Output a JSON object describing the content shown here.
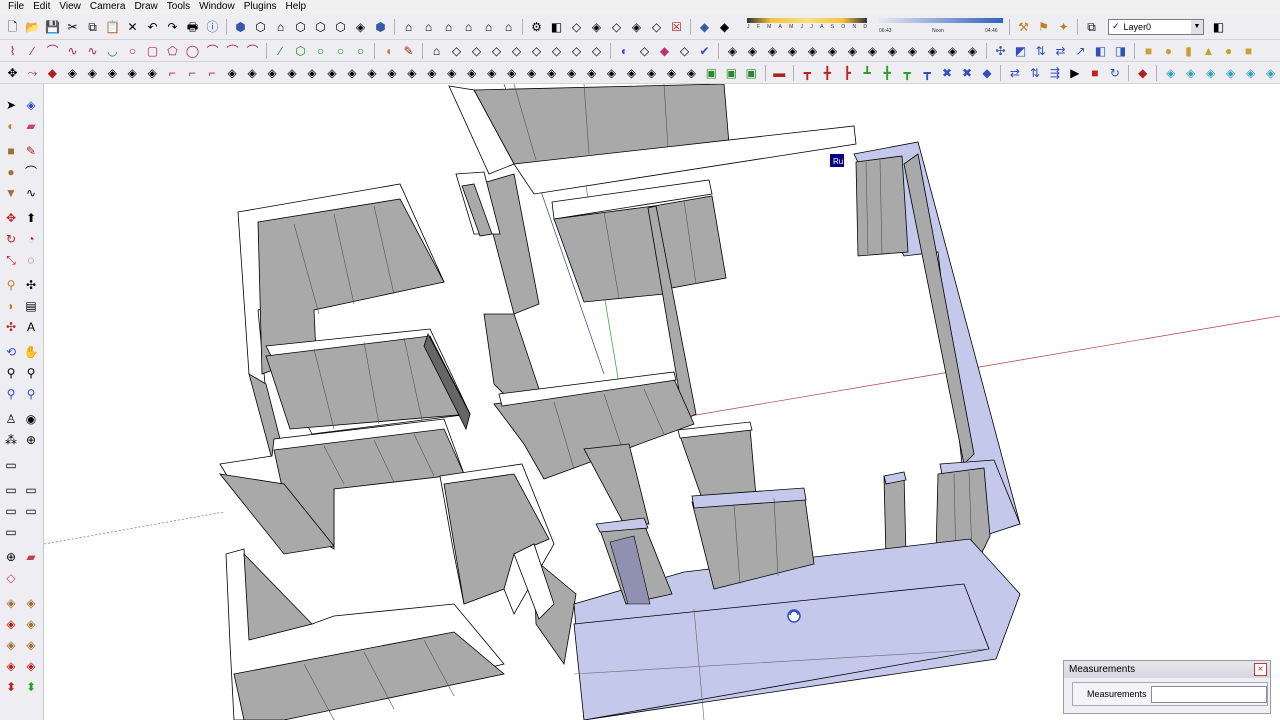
{
  "menu": [
    "File",
    "Edit",
    "View",
    "Camera",
    "Draw",
    "Tools",
    "Window",
    "Plugins",
    "Help"
  ],
  "shadow_settings": {
    "months": [
      "J",
      "F",
      "M",
      "A",
      "M",
      "J",
      "J",
      "A",
      "S",
      "O",
      "N",
      "D"
    ],
    "sunrise": "06:43",
    "noon": "Noon",
    "sunset": "04:46"
  },
  "layer": {
    "name": "Layer0",
    "visible_check": "✓"
  },
  "viewport": {
    "tag_label": "Ru"
  },
  "measurements": {
    "title": "Measurements",
    "label": "Measurements",
    "value": ""
  },
  "colors": {
    "face_gray": "#a9a9a9",
    "face_light": "#ffffff",
    "face_blue": "#c4c9ec",
    "axis_blue": "#3a3aa0",
    "axis_green": "#2aa02a",
    "axis_red": "#b04040",
    "toolbar_bg": "#eeeef2"
  },
  "toolbar_icons": {
    "row1": [
      "new-icon",
      "open-icon",
      "save-icon",
      "cut-icon",
      "copy-icon",
      "paste-icon",
      "erase-icon",
      "undo-icon",
      "redo-icon",
      "print-icon",
      "model-info-icon",
      "iso-view-icon",
      "top-view-icon",
      "front-view-icon",
      "right-view-icon",
      "back-view-icon",
      "left-view-icon",
      "xray-icon",
      "wireframe-icon",
      "hidden-line-icon",
      "shaded-icon",
      "textured-icon",
      "monochrome-icon",
      "shadow-toggle-icon",
      "fog-icon",
      "get-models-icon",
      "share-model-icon",
      "component-icon",
      "ruby-console-icon"
    ],
    "row2": [
      "freehand-icon",
      "line-icon",
      "arc-icon",
      "circle-icon",
      "polygon-icon",
      "rect-icon",
      "bezier-icon",
      "spline-icon",
      "offset-icon",
      "pushpull-icon",
      "follow-me-icon",
      "intersect-icon",
      "union-icon",
      "subtract-icon",
      "trim-icon",
      "split-icon",
      "outer-shell-icon",
      "sandbox-icon",
      "smoove-icon",
      "stamp-icon",
      "drape-icon",
      "flip-edge-icon",
      "add-detail-icon",
      "solid-box-icon",
      "solid-cylinder-icon",
      "solid-cone-icon",
      "solid-sphere-icon"
    ],
    "row3": [
      "dimension-icon",
      "protractor-icon",
      "text-icon",
      "axes-icon",
      "3d-text-icon",
      "section-plane-icon",
      "walk-icon",
      "look-around-icon",
      "position-camera-icon",
      "zoom-window-icon",
      "zoom-extents-icon",
      "previous-view-icon",
      "next-view-icon",
      "scale-icon",
      "rotate-icon",
      "move-icon",
      "array-icon",
      "align-icon",
      "mirror-icon",
      "weld-icon",
      "tape-icon",
      "label-icon"
    ]
  },
  "left_toolbar_icons": [
    [
      "select-icon",
      "make-component-icon"
    ],
    [
      "paint-bucket-icon",
      "eraser-icon"
    ],
    [
      "rectangle-icon",
      "line-icon"
    ],
    [
      "circle-icon",
      "arc-icon"
    ],
    [
      "polygon-icon",
      "freehand-icon"
    ],
    [
      "move-icon",
      "pushpull-icon"
    ],
    [
      "rotate-icon",
      "follow-me-icon"
    ],
    [
      "scale-icon",
      "offset-icon"
    ],
    [
      "tape-measure-icon",
      "dimension-icon"
    ],
    [
      "protractor-icon",
      "text-icon"
    ],
    [
      "axes-icon",
      "3d-text-icon"
    ],
    [
      "orbit-icon",
      "pan-icon"
    ],
    [
      "zoom-icon",
      "zoom-window-icon"
    ],
    [
      "zoom-extents-icon",
      "previous-icon"
    ],
    [
      "position-camera-icon",
      "look-around-icon"
    ],
    [
      "walk-icon",
      "section-plane-icon"
    ],
    [
      "sandbox-from-contours-icon",
      "sandbox-scratch-icon"
    ],
    [
      "smoove-icon",
      "stamp-icon"
    ],
    [
      "drape-icon",
      "add-detail-icon"
    ],
    [
      "flip-edge-icon",
      "flatten-icon"
    ]
  ]
}
